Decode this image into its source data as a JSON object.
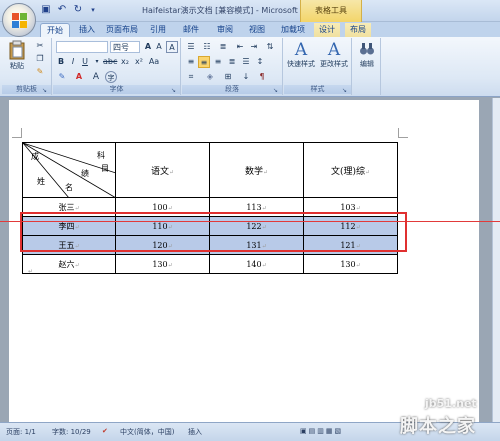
{
  "window": {
    "title": "Haifeistar演示文档 [兼容模式] - Microsoft Word",
    "context_tab": "表格工具"
  },
  "ribbon": {
    "tabs": [
      "开始",
      "插入",
      "页面布局",
      "引用",
      "邮件",
      "审阅",
      "视图",
      "加载项",
      "设计",
      "布局"
    ],
    "font_size": "四号",
    "groups": {
      "clipboard": "剪贴板",
      "font": "字体",
      "paragraph": "段落",
      "styles": "样式",
      "editing": "编辑"
    },
    "paste_label": "粘贴",
    "quick_styles_label": "快速样式",
    "change_styles_label": "更改样式",
    "editing_label": "编辑"
  },
  "document": {
    "table": {
      "diag_header": {
        "a": "成",
        "b": "科",
        "c": "绩",
        "d": "目",
        "e": "姓",
        "f": "名"
      },
      "columns": [
        "语文",
        "数学",
        "文(理)综"
      ],
      "rows": [
        {
          "name": "张三",
          "values": [
            "100",
            "113",
            "103"
          ]
        },
        {
          "name": "李四",
          "values": [
            "110",
            "122",
            "112"
          ]
        },
        {
          "name": "王五",
          "values": [
            "120",
            "131",
            "121"
          ]
        },
        {
          "name": "赵六",
          "values": [
            "130",
            "140",
            "130"
          ]
        }
      ]
    }
  },
  "status": {
    "page": "页面: 1/1",
    "words": "字数: 10/29",
    "language": "中文(简体，中国)",
    "mode": "插入"
  },
  "watermark": {
    "url": "jb51.net",
    "site": "脚本之家"
  },
  "colors": {
    "selection": "#b8cae8",
    "annotation": "#e03030",
    "context_tab": "#f3d56a"
  }
}
